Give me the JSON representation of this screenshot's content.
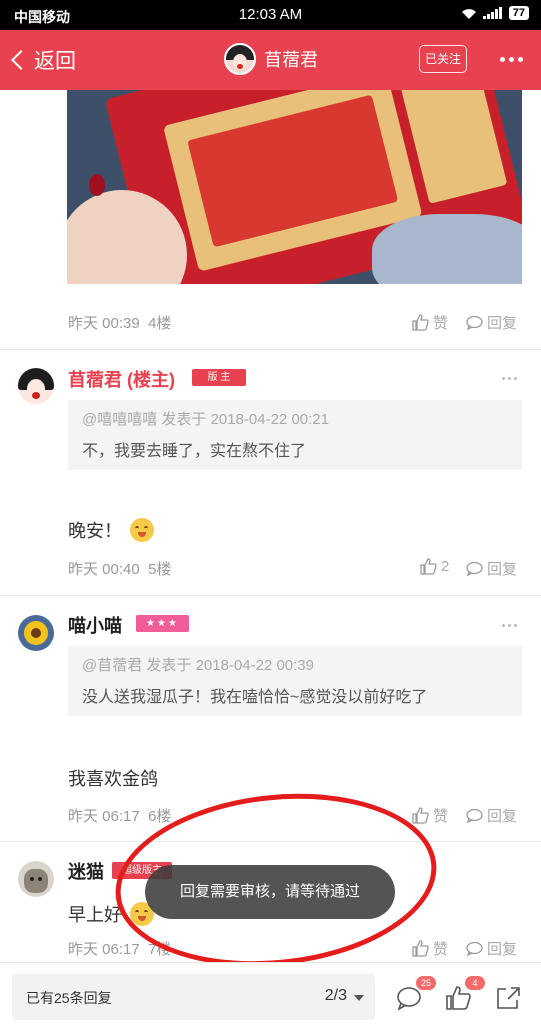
{
  "status_bar": {
    "carrier": "中国移动",
    "time": "12:03 AM",
    "battery": "77"
  },
  "header": {
    "back_label": "返回",
    "title": "苜蓿君",
    "follow_label": "已关注"
  },
  "floors": [
    {
      "time": "昨天 00:39",
      "floor": "4楼",
      "like_label": "赞",
      "reply_label": "回复"
    },
    {
      "username": "苜蓿君 (楼主)",
      "badge": "版 主",
      "quote_header": "@嘻嘻嘻嘻 发表于 2018-04-22 00:21",
      "quote_body": "不，我要去睡了，实在熬不住了",
      "text": "晚安！",
      "time": "昨天 00:40",
      "floor": "5楼",
      "like_label": "2",
      "reply_label": "回复"
    },
    {
      "username": "喵小喵",
      "badge": "★★★",
      "quote_header": "@苜蓿君 发表于 2018-04-22 00:39",
      "quote_body": "没人送我湿瓜子！我在嗑恰恰~感觉没以前好吃了",
      "text": "我喜欢金鸽",
      "time": "昨天 06:17",
      "floor": "6楼",
      "like_label": "赞",
      "reply_label": "回复"
    },
    {
      "username": "迷猫",
      "badge": "超级版主",
      "text": "早上好",
      "time": "昨天 06:17",
      "floor": "7楼",
      "like_label": "赞",
      "reply_label": "回复"
    }
  ],
  "toast": "回复需要审核，请等待通过",
  "bottom_bar": {
    "reply_count_text": "已有25条回复",
    "page": "2/3",
    "comment_count": "25",
    "like_count": "4"
  },
  "colors": {
    "accent": "#e8414f",
    "annotation": "#e41c1c"
  }
}
